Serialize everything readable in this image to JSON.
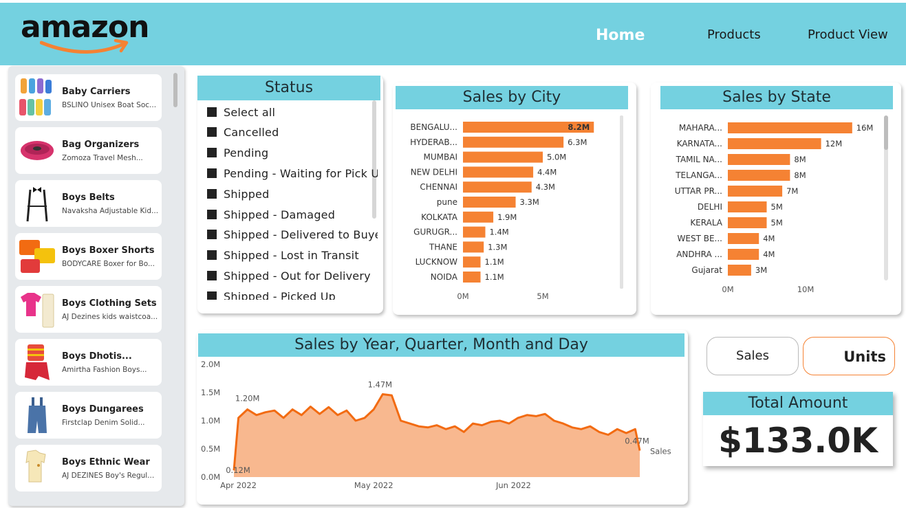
{
  "header": {
    "logo_text": "amazon",
    "nav": [
      {
        "label": "Home",
        "active": true
      },
      {
        "label": "Products",
        "active": false
      },
      {
        "label": "Product View",
        "active": false
      }
    ],
    "bar_color": "#74d1e0"
  },
  "sidebar": {
    "items": [
      {
        "title": "Baby Carriers",
        "subtitle": "BSLINO Unisex Boat Soc..."
      },
      {
        "title": "Bag Organizers",
        "subtitle": "Zomoza Travel Mesh..."
      },
      {
        "title": "Boys Belts",
        "subtitle": "Navaksha Adjustable Kid..."
      },
      {
        "title": "Boys Boxer Shorts",
        "subtitle": "BODYCARE Boxer for Bo..."
      },
      {
        "title": "Boys Clothing Sets",
        "subtitle": "AJ Dezines kids waistcoa..."
      },
      {
        "title": "Boys Dhotis...",
        "subtitle": "Amirtha Fashion Boys..."
      },
      {
        "title": "Boys Dungarees",
        "subtitle": "Firstclap Denim Solid..."
      },
      {
        "title": "Boys Ethnic Wear",
        "subtitle": "AJ DEZINES Boy's Regul..."
      }
    ]
  },
  "status": {
    "title": "Status",
    "items": [
      "Select all",
      "Cancelled",
      "Pending",
      "Pending - Waiting for Pick Up",
      "Shipped",
      "Shipped - Damaged",
      "Shipped - Delivered to Buyer",
      "Shipped - Lost in Transit",
      "Shipped - Out for Delivery",
      "Shipped - Picked Up"
    ]
  },
  "sales_city": {
    "title": "Sales by City",
    "ticks": [
      "0M",
      "5M"
    ]
  },
  "sales_state": {
    "title": "Sales by State",
    "ticks": [
      "0M",
      "10M"
    ]
  },
  "sales_time": {
    "title": "Sales by Year, Quarter, Month and Day",
    "y_ticks": [
      "2.0M",
      "1.5M",
      "1.0M",
      "0.5M",
      "0.0M"
    ],
    "x_ticks": [
      "Apr 2022",
      "May 2022",
      "Jun 2022"
    ],
    "annotations": [
      "0.12M",
      "1.20M",
      "1.47M",
      "0.47M"
    ],
    "series_label": "Sales"
  },
  "toggles": {
    "sales": "Sales",
    "units": "Units"
  },
  "total": {
    "title": "Total Amount",
    "value": "$133.0K"
  },
  "colors": {
    "bar": "#f58233",
    "area_fill": "#f8b88f",
    "line": "#f26b12",
    "accent": "#74d1e0"
  },
  "chart_data": [
    {
      "type": "bar",
      "title": "Sales by City",
      "categories": [
        "BENGALU...",
        "HYDERAB...",
        "MUMBAI",
        "NEW DELHI",
        "CHENNAI",
        "pune",
        "KOLKATA",
        "GURUGR...",
        "THANE",
        "LUCKNOW",
        "NOIDA"
      ],
      "values": [
        8.2,
        6.3,
        5.0,
        4.4,
        4.3,
        3.3,
        1.9,
        1.4,
        1.3,
        1.1,
        1.1
      ],
      "value_labels": [
        "8.2M",
        "6.3M",
        "5.0M",
        "4.4M",
        "4.3M",
        "3.3M",
        "1.9M",
        "1.4M",
        "1.3M",
        "1.1M",
        "1.1M"
      ],
      "xlim": [
        0,
        10
      ]
    },
    {
      "type": "bar",
      "title": "Sales by State",
      "categories": [
        "MAHARA...",
        "KARNATA...",
        "TAMIL NA...",
        "TELANGA...",
        "UTTAR PR...",
        "DELHI",
        "KERALA",
        "WEST BE...",
        "ANDHRA ...",
        "Gujarat"
      ],
      "values": [
        16,
        12,
        8,
        8,
        7,
        5,
        5,
        4,
        4,
        3
      ],
      "value_labels": [
        "16M",
        "12M",
        "8M",
        "8M",
        "7M",
        "5M",
        "5M",
        "4M",
        "4M",
        "3M"
      ],
      "xlim": [
        0,
        20
      ]
    },
    {
      "type": "area",
      "title": "Sales by Year, Quarter, Month and Day",
      "x": [
        "2022-03-31",
        "2022-04-01",
        "2022-04-03",
        "2022-04-05",
        "2022-04-07",
        "2022-04-09",
        "2022-04-11",
        "2022-04-13",
        "2022-04-15",
        "2022-04-17",
        "2022-04-19",
        "2022-04-21",
        "2022-04-23",
        "2022-04-25",
        "2022-04-27",
        "2022-04-29",
        "2022-05-01",
        "2022-05-03",
        "2022-05-05",
        "2022-05-07",
        "2022-05-09",
        "2022-05-11",
        "2022-05-13",
        "2022-05-15",
        "2022-05-17",
        "2022-05-19",
        "2022-05-21",
        "2022-05-23",
        "2022-05-25",
        "2022-05-27",
        "2022-05-29",
        "2022-05-31",
        "2022-06-02",
        "2022-06-04",
        "2022-06-06",
        "2022-06-08",
        "2022-06-10",
        "2022-06-12",
        "2022-06-14",
        "2022-06-16",
        "2022-06-18",
        "2022-06-20",
        "2022-06-22",
        "2022-06-24",
        "2022-06-26",
        "2022-06-28",
        "2022-06-29"
      ],
      "y": [
        0.12,
        1.05,
        1.2,
        1.1,
        1.15,
        1.18,
        1.05,
        1.2,
        1.1,
        1.25,
        1.12,
        1.24,
        1.1,
        1.18,
        1.0,
        1.05,
        1.2,
        1.47,
        1.45,
        1.0,
        0.95,
        0.9,
        0.88,
        0.92,
        0.85,
        0.9,
        0.8,
        0.95,
        0.92,
        0.98,
        1.0,
        0.95,
        1.05,
        1.1,
        1.08,
        1.12,
        1.0,
        0.95,
        0.88,
        0.85,
        0.9,
        0.8,
        0.75,
        0.85,
        0.78,
        0.85,
        0.47
      ],
      "ylim": [
        0,
        2.0
      ],
      "ylabel": "",
      "series": [
        {
          "name": "Sales"
        }
      ]
    }
  ]
}
